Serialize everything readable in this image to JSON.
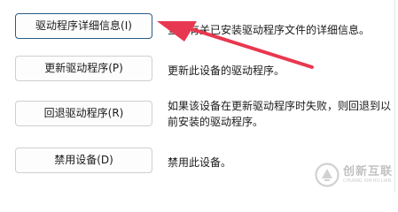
{
  "driver_actions": [
    {
      "button_label": "驱动程序详细信息(I)",
      "description": "查看有关已安装驱动程序文件的详细信息。"
    },
    {
      "button_label": "更新驱动程序(P)",
      "description": "更新此设备的驱动程序。"
    },
    {
      "button_label": "回退驱动程序(R)",
      "description": "如果该设备在更新驱动程序时失败，则回退到以前安装的驱动程序。"
    },
    {
      "button_label": "禁用设备(D)",
      "description": "禁用此设备。"
    }
  ],
  "annotation": {
    "arrow_color": "#e8384f"
  },
  "watermark": {
    "text": "创新互联",
    "subtext": "CHUANG XIN HU LIAN"
  }
}
